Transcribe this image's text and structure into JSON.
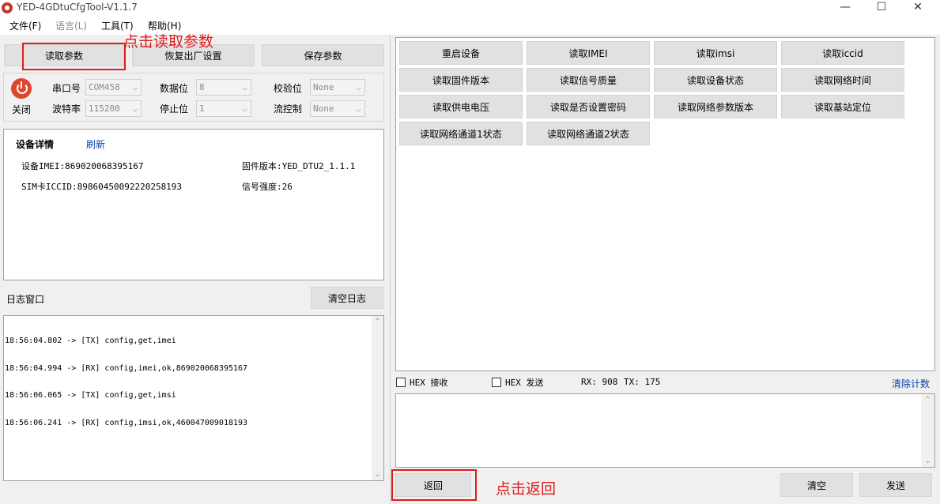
{
  "window": {
    "title": "YED-4GDtuCfgTool-V1.1.7",
    "controls": {
      "minimize": "—",
      "maximize": "☐",
      "close": "✕"
    }
  },
  "menu": [
    {
      "label": "文件(F)",
      "disabled": false
    },
    {
      "label": "语言(L)",
      "disabled": true
    },
    {
      "label": "工具(T)",
      "disabled": false
    },
    {
      "label": "帮助(H)",
      "disabled": false
    }
  ],
  "toolbar": {
    "read_params": "读取参数",
    "factory_reset": "恢复出厂设置",
    "save_params": "保存参数"
  },
  "serial": {
    "power_label": "关闭",
    "port_label": "串口号",
    "port_value": "COM458",
    "baud_label": "波特率",
    "baud_value": "115200",
    "databits_label": "数据位",
    "databits_value": "8",
    "stopbits_label": "停止位",
    "stopbits_value": "1",
    "parity_label": "校验位",
    "parity_value": "None",
    "flow_label": "流控制",
    "flow_value": "None"
  },
  "device": {
    "title": "设备详情",
    "refresh": "刷新",
    "imei": "设备IMEI:869020068395167",
    "firmware": "固件版本:YED_DTU2_1.1.1",
    "iccid": "SIM卡ICCID:89860450092220258193",
    "signal": "信号强度:26"
  },
  "log": {
    "title": "日志窗口",
    "clear": "清空日志",
    "lines": [
      "18:56:04.802 -> [TX] config,get,imei",
      "18:56:04.994 -> [RX] config,imei,ok,869020068395167",
      "18:56:06.065 -> [TX] config,get,imsi",
      "18:56:06.241 -> [RX] config,imsi,ok,460047009018193"
    ]
  },
  "commands": [
    "重启设备",
    "读取IMEI",
    "读取imsi",
    "读取iccid",
    "读取固件版本",
    "读取信号质量",
    "读取设备状态",
    "读取网络时间",
    "读取供电电压",
    "读取是否设置密码",
    "读取网络参数版本",
    "读取基站定位",
    "读取网络通道1状态",
    "读取网络通道2状态"
  ],
  "hexbar": {
    "hex_recv": "HEX 接收",
    "hex_send": "HEX 发送",
    "rx": "RX: 908",
    "tx": "TX: 175",
    "clear_count": "清除计数"
  },
  "bottom": {
    "back": "返回",
    "clear": "清空",
    "send": "发送"
  },
  "annotations": {
    "read_params": "点击读取参数",
    "back": "点击返回"
  },
  "colors": {
    "annotation": "#e21b1b",
    "power_icon": "#e0452f",
    "link": "#0645ad"
  }
}
